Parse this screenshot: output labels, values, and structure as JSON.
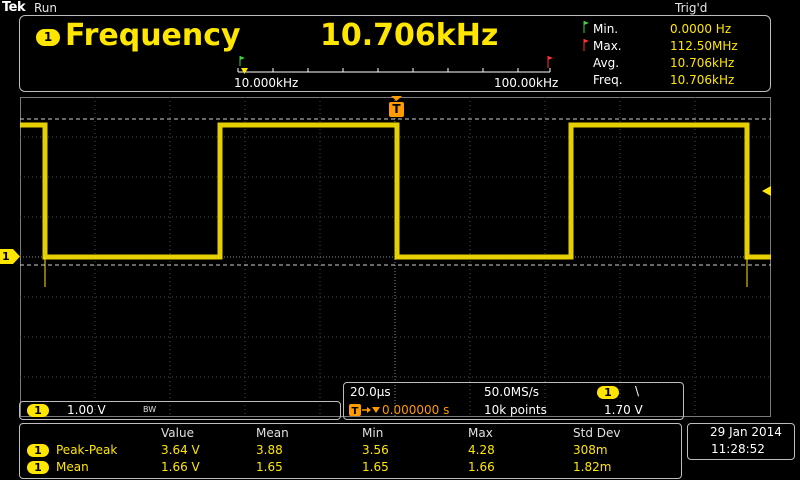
{
  "header": {
    "brand": "Tek",
    "status": "Run",
    "trigger_status": "Trig'd"
  },
  "measurement": {
    "channel": "1",
    "title": "Frequency",
    "value": "10.706kHz",
    "scale_min": "10.000kHz",
    "scale_max": "100.00kHz",
    "stats": [
      {
        "label": "Min.",
        "value": "0.0000 Hz"
      },
      {
        "label": "Max.",
        "value": "112.50MHz"
      },
      {
        "label": "Avg.",
        "value": "10.706kHz"
      },
      {
        "label": "Freq.",
        "value": "10.706kHz"
      }
    ]
  },
  "channel_box": {
    "channel": "1",
    "volts": "1.00 V",
    "bw": "BW"
  },
  "timebase": {
    "time_div": "20.0µs",
    "sample_rate": "50.0MS/s",
    "trigger_channel": "1",
    "trigger_slope": "\\",
    "trigger_offset": "0.000000 s",
    "record_length": "10k points",
    "trigger_level": "1.70 V"
  },
  "meas_table": {
    "headers": [
      "Value",
      "Mean",
      "Min",
      "Max",
      "Std Dev"
    ],
    "rows": [
      {
        "channel": "1",
        "name": "Peak-Peak",
        "cells": [
          "3.64 V",
          "3.88",
          "3.56",
          "4.28",
          "308m"
        ]
      },
      {
        "channel": "1",
        "name": "Mean",
        "cells": [
          "1.66 V",
          "1.65",
          "1.65",
          "1.66",
          "1.82m"
        ]
      }
    ]
  },
  "datetime": {
    "date": "29 Jan  2014",
    "time": "11:28:52"
  },
  "marker_labels": {
    "ground": "1",
    "trigger": "T"
  },
  "colors": {
    "trace": "#ffe600",
    "grid": "#5a5a5a",
    "frame": "#bdbdbd"
  }
}
